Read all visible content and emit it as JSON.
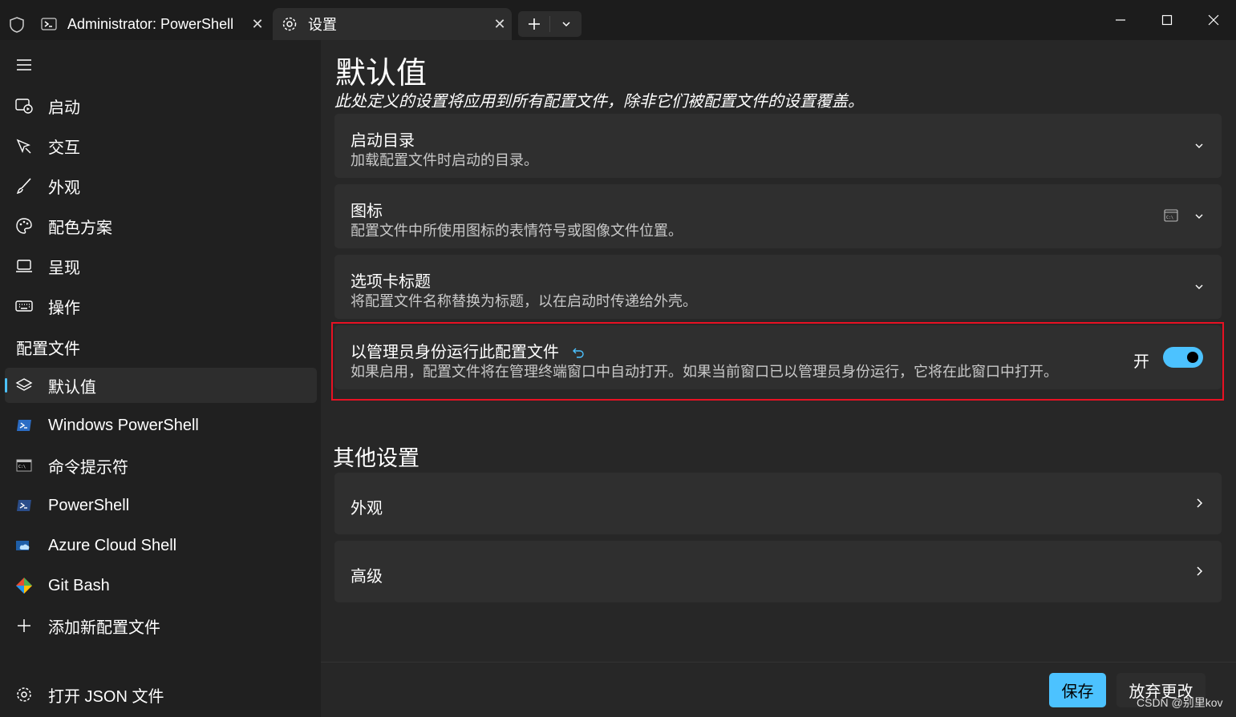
{
  "titlebar": {
    "tabs": [
      {
        "label": "Administrator: PowerShell",
        "icon": "powershell-icon"
      },
      {
        "label": "设置",
        "icon": "gear-icon"
      }
    ],
    "new_tab_icon": "plus-icon",
    "dropdown_icon": "chevron-down-icon",
    "window_controls": [
      "minimize-icon",
      "maximize-icon",
      "close-icon"
    ]
  },
  "sidebar": {
    "items": [
      {
        "label": "启动",
        "icon": "startup-icon"
      },
      {
        "label": "交互",
        "icon": "interaction-icon"
      },
      {
        "label": "外观",
        "icon": "brush-icon"
      },
      {
        "label": "配色方案",
        "icon": "palette-icon"
      },
      {
        "label": "呈现",
        "icon": "laptop-icon"
      },
      {
        "label": "操作",
        "icon": "keyboard-icon"
      }
    ],
    "profiles_header": "配置文件",
    "profiles": [
      {
        "label": "默认值",
        "icon": "layers-icon",
        "selected": true
      },
      {
        "label": "Windows PowerShell",
        "icon": "powershell-icon"
      },
      {
        "label": "命令提示符",
        "icon": "cmd-icon"
      },
      {
        "label": "PowerShell",
        "icon": "powershell-icon"
      },
      {
        "label": "Azure Cloud Shell",
        "icon": "azure-icon"
      },
      {
        "label": "Git Bash",
        "icon": "git-icon"
      },
      {
        "label": "添加新配置文件",
        "icon": "plus-icon"
      }
    ],
    "open_json": {
      "label": "打开 JSON 文件",
      "icon": "gear-icon"
    }
  },
  "main": {
    "title": "默认值",
    "subtitle": "此处定义的设置将应用到所有配置文件，除非它们被配置文件的设置覆盖。",
    "cards": [
      {
        "title": "启动目录",
        "desc": "加载配置文件时启动的目录。"
      },
      {
        "title": "图标",
        "desc": "配置文件中所使用图标的表情符号或图像文件位置。"
      },
      {
        "title": "选项卡标题",
        "desc": "将配置文件名称替换为标题，以在启动时传递给外壳。"
      },
      {
        "title": "以管理员身份运行此配置文件",
        "desc": "如果启用，配置文件将在管理终端窗口中自动打开。如果当前窗口已以管理员身份运行，它将在此窗口中打开。",
        "toggle_label": "开",
        "toggle_on": true
      }
    ],
    "other_title": "其他设置",
    "other_cards": [
      {
        "title": "外观"
      },
      {
        "title": "高级"
      }
    ],
    "save_label": "保存",
    "discard_label": "放弃更改"
  },
  "watermark": "CSDN @别里kov",
  "colors": {
    "accent": "#4cc2ff",
    "highlight": "#e81123",
    "card": "#2f2f2f",
    "background": "#272727"
  }
}
